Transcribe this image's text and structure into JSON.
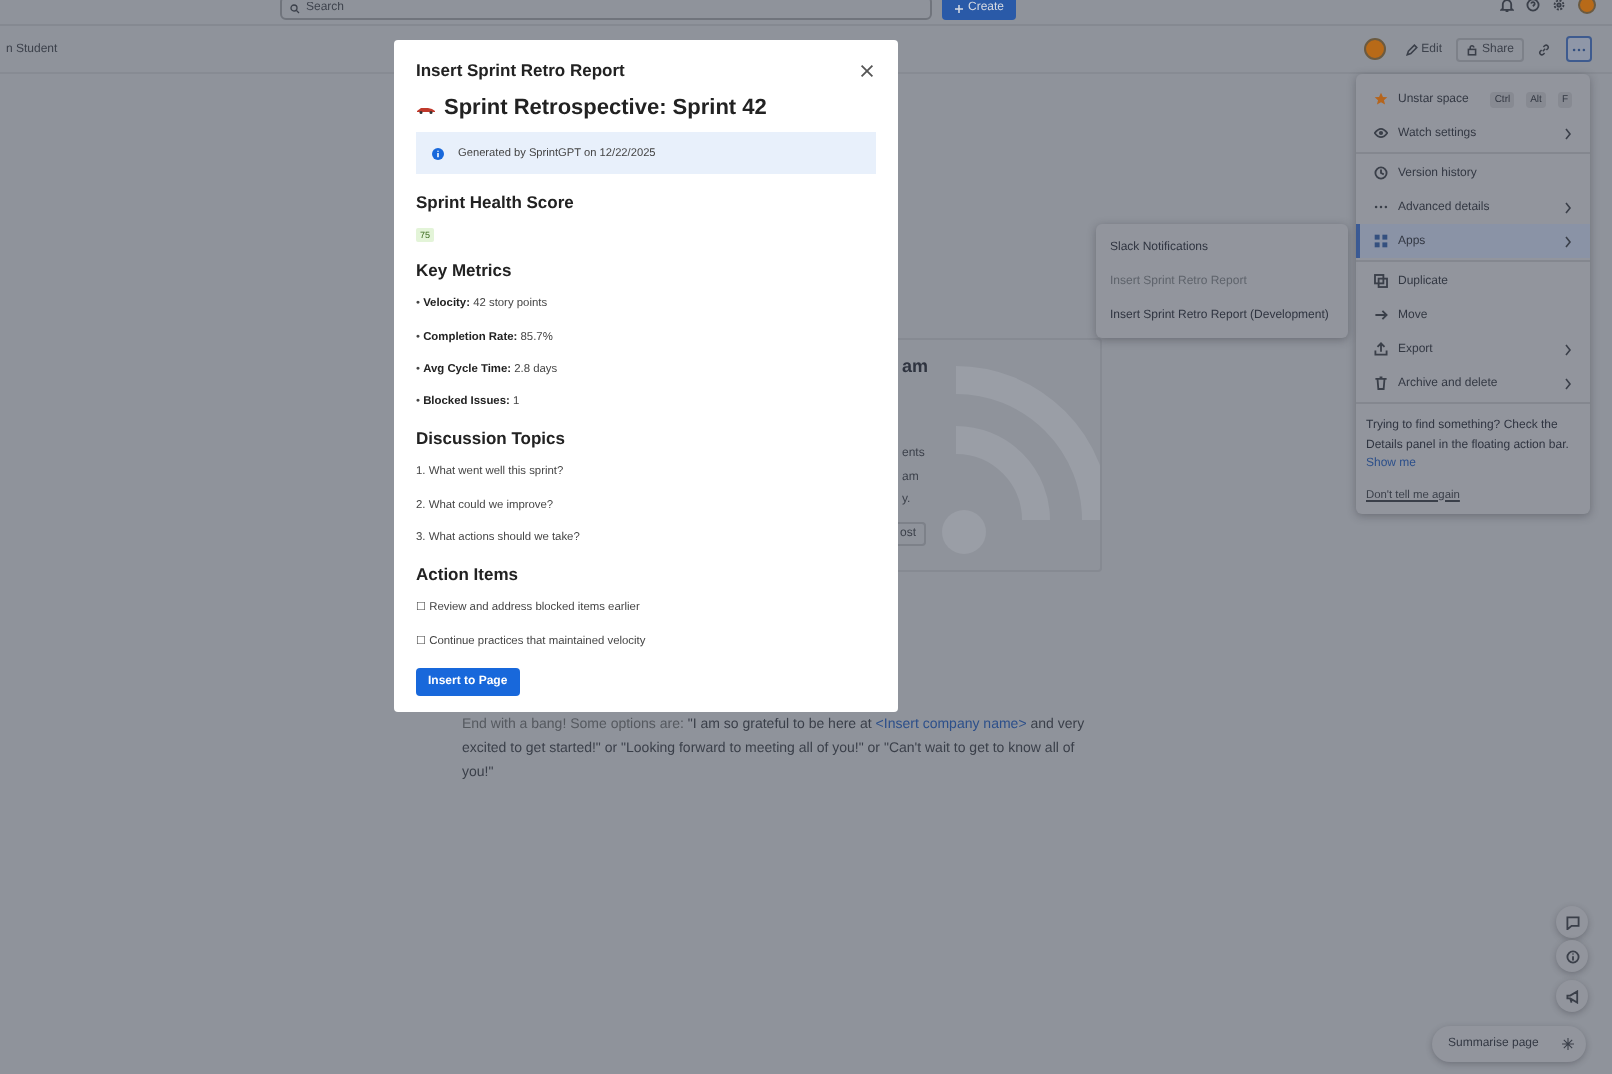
{
  "topbar": {
    "search": {
      "placeholder": "Search"
    },
    "create_button": "Create"
  },
  "page_header": {
    "breadcrumb": "n Student",
    "edit_button": "Edit",
    "share_button": "Share"
  },
  "page_body": {
    "card": {
      "heading": "am",
      "lines": [
        "ents",
        "am",
        "y."
      ],
      "button": "ost"
    },
    "tip": {
      "lead": "End with a bang! Some options are: ",
      "quote_start": "\"I am so grateful to be here at ",
      "link": "<Insert company name>",
      "quote_end": " and very excited to get started!\" or \"Looking forward to meeting all of you!\" or \"Can't wait to get to know all of you!\""
    }
  },
  "menu": {
    "groups": [
      [
        {
          "label": "Unstar space",
          "shortcut": [
            "Ctrl",
            "Alt",
            "F"
          ],
          "has_submenu": false,
          "selected": false
        },
        {
          "label": "Watch settings",
          "has_submenu": true,
          "selected": false
        }
      ],
      [
        {
          "label": "Version history",
          "has_submenu": false,
          "selected": false
        },
        {
          "label": "Advanced details",
          "has_submenu": true,
          "selected": false
        },
        {
          "label": "Apps",
          "has_submenu": true,
          "selected": true
        }
      ],
      [
        {
          "label": "Duplicate",
          "has_submenu": false,
          "selected": false
        },
        {
          "label": "Move",
          "has_submenu": false,
          "selected": false
        },
        {
          "label": "Export",
          "has_submenu": true,
          "selected": false
        },
        {
          "label": "Archive and delete",
          "has_submenu": true,
          "selected": false
        }
      ]
    ],
    "hint": "Trying to find something? Check the Details panel in the floating action bar.",
    "hint_link": "Show me",
    "dismiss_link": "Don't tell me again"
  },
  "submenu": {
    "items": [
      {
        "label": "Slack Notifications",
        "disabled": false
      },
      {
        "label": "Insert Sprint Retro Report",
        "disabled": true
      },
      {
        "label": "Insert Sprint Retro Report (Development)",
        "disabled": false
      }
    ]
  },
  "dialog": {
    "title": "Insert Sprint Retro Report",
    "heading": "Sprint Retrospective: Sprint 42",
    "banner": "Generated by SprintGPT on 12/22/2025",
    "sections": [
      {
        "title": "Sprint Health Score",
        "kind": "score",
        "badge": "75"
      },
      {
        "title": "Key Metrics",
        "kind": "list",
        "items": [
          "• **Velocity:** 42 story points",
          "• **Completion Rate:** 85.7%",
          "• **Avg Cycle Time:** 2.8 days",
          "• **Blocked Issues:** 1"
        ]
      },
      {
        "title": "Discussion Topics",
        "kind": "list",
        "items": [
          "1. What went well this sprint?",
          "2. What could we improve?",
          "3. What actions should we take?"
        ]
      },
      {
        "title": "Action Items",
        "kind": "list",
        "items": [
          "☐ Review and address blocked items earlier",
          "☐ Continue practices that maintained velocity"
        ]
      }
    ],
    "insert_button": "Insert to Page"
  },
  "summarise_button": "Summarise page"
}
